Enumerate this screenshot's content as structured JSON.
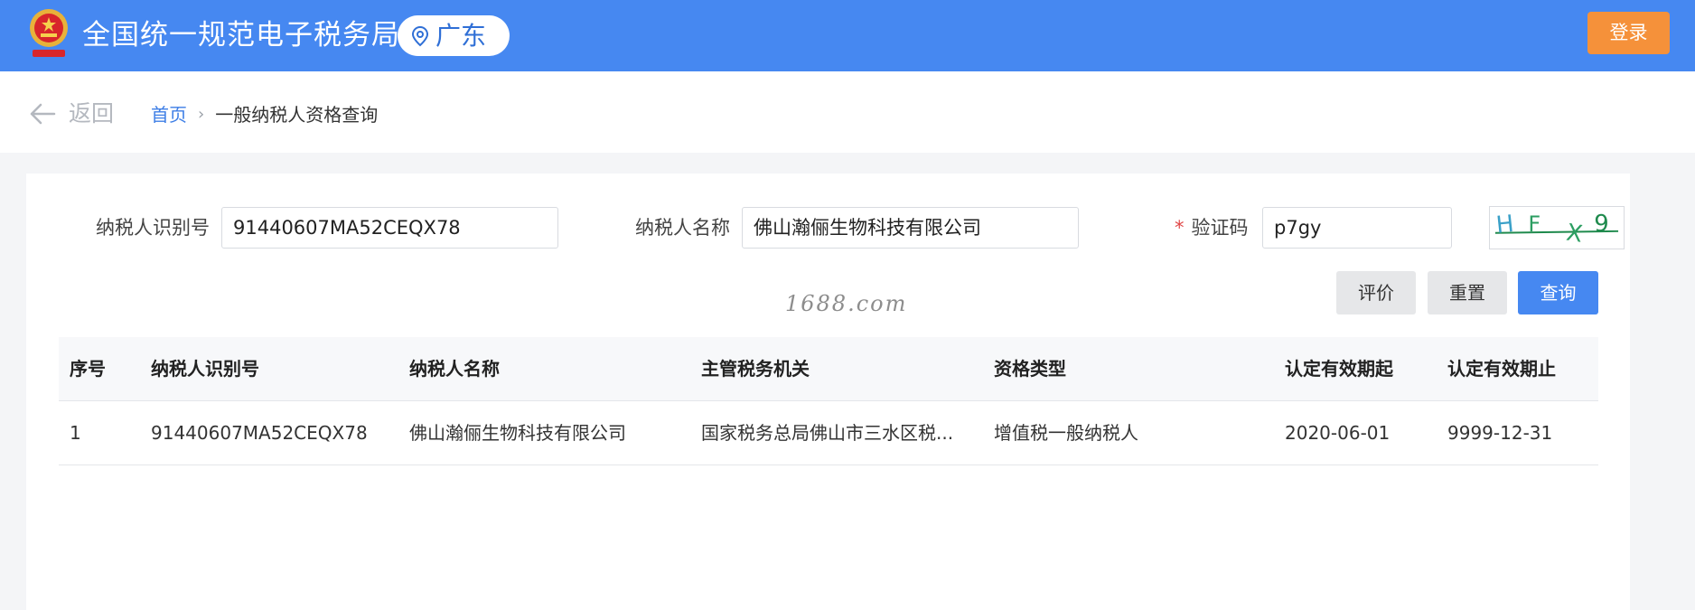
{
  "header": {
    "site_title": "全国统一规范电子税务局",
    "region": "广东",
    "login_label": "登录",
    "brand_color": "#4688f1",
    "login_color": "#f5913a",
    "emblem_icon": "national-emblem-icon",
    "location_icon": "location-pin-icon"
  },
  "breadcrumb": {
    "back_label": "返回",
    "home": "首页",
    "separator": "›",
    "current": "一般纳税人资格查询"
  },
  "form": {
    "taxpayer_id_label": "纳税人识别号",
    "taxpayer_id_value": "91440607MA52CEQX78",
    "taxpayer_name_label": "纳税人名称",
    "taxpayer_name_value": "佛山瀚俪生物科技有限公司",
    "captcha_required_mark": "*",
    "captcha_label": "验证码",
    "captcha_value": "p7gy",
    "captcha_image_text": "HFX9"
  },
  "buttons": {
    "rate": "评价",
    "reset": "重置",
    "query": "查询"
  },
  "watermark": "1688.com",
  "table": {
    "headers": [
      "序号",
      "纳税人识别号",
      "纳税人名称",
      "主管税务机关",
      "资格类型",
      "认定有效期起",
      "认定有效期止"
    ],
    "rows": [
      [
        "1",
        "91440607MA52CEQX78",
        "佛山瀚俪生物科技有限公司",
        "国家税务总局佛山市三水区税...",
        "增值税一般纳税人",
        "2020-06-01",
        "9999-12-31"
      ]
    ]
  }
}
